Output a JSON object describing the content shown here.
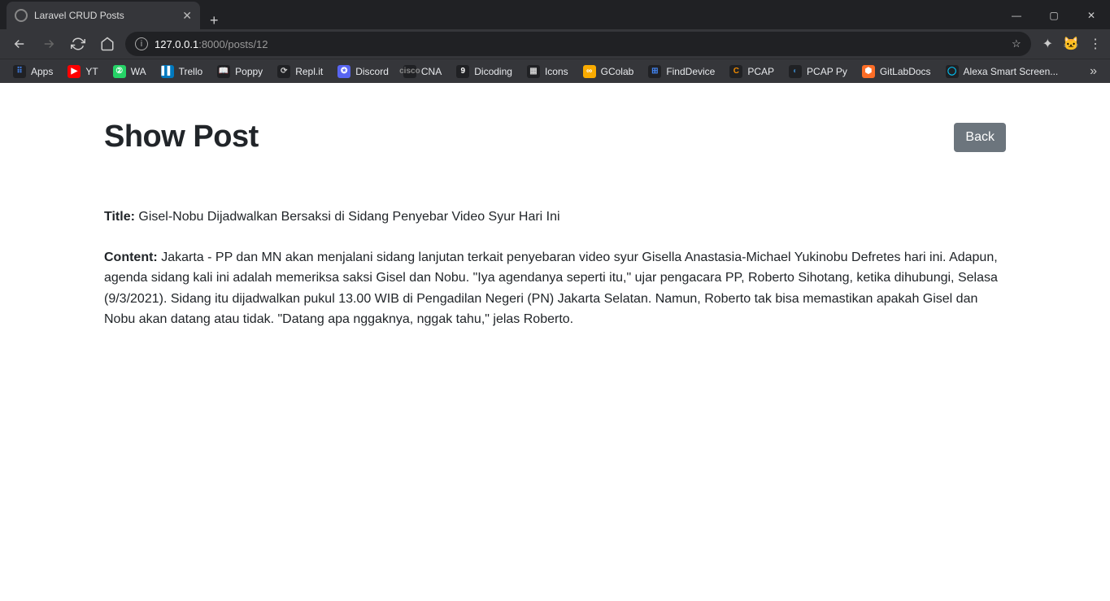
{
  "browser": {
    "tab_title": "Laravel CRUD Posts",
    "url_host": "127.0.0.1",
    "url_port": ":8000",
    "url_path": "/posts/12",
    "bookmarks": [
      {
        "label": "Apps",
        "icon_bg": "#202124",
        "icon_txt": "⠿",
        "icon_color": "#4285f4"
      },
      {
        "label": "YT",
        "icon_bg": "#ff0000",
        "icon_txt": "▶",
        "icon_color": "#fff"
      },
      {
        "label": "WA",
        "icon_bg": "#25d366",
        "icon_txt": "②",
        "icon_color": "#fff"
      },
      {
        "label": "Trello",
        "icon_bg": "#0079bf",
        "icon_txt": "▌▌",
        "icon_color": "#fff"
      },
      {
        "label": "Poppy",
        "icon_bg": "#202124",
        "icon_txt": "📖",
        "icon_color": "#ccc"
      },
      {
        "label": "Repl.it",
        "icon_bg": "#202124",
        "icon_txt": "⟳",
        "icon_color": "#ccc"
      },
      {
        "label": "Discord",
        "icon_bg": "#5865f2",
        "icon_txt": "✪",
        "icon_color": "#fff"
      },
      {
        "label": "CNA",
        "icon_bg": "#202124",
        "icon_txt": "cisco",
        "icon_color": "#888"
      },
      {
        "label": "Dicoding",
        "icon_bg": "#202124",
        "icon_txt": "9",
        "icon_color": "#fff"
      },
      {
        "label": "Icons",
        "icon_bg": "#202124",
        "icon_txt": "▦",
        "icon_color": "#ccc"
      },
      {
        "label": "GColab",
        "icon_bg": "#f9ab00",
        "icon_txt": "∞",
        "icon_color": "#fff"
      },
      {
        "label": "FindDevice",
        "icon_bg": "#202124",
        "icon_txt": "⊞",
        "icon_color": "#4285f4"
      },
      {
        "label": "PCAP",
        "icon_bg": "#202124",
        "icon_txt": "C",
        "icon_color": "#f28b00"
      },
      {
        "label": "PCAP Py",
        "icon_bg": "#202124",
        "icon_txt": "◐",
        "icon_color": "#3776ab"
      },
      {
        "label": "GitLabDocs",
        "icon_bg": "#fc6d26",
        "icon_txt": "⬢",
        "icon_color": "#fff"
      },
      {
        "label": "Alexa Smart Screen...",
        "icon_bg": "#202124",
        "icon_txt": "◯",
        "icon_color": "#00caff"
      }
    ]
  },
  "page": {
    "heading": "Show Post",
    "back_label": "Back",
    "title_label": "Title:",
    "title_value": "Gisel-Nobu Dijadwalkan Bersaksi di Sidang Penyebar Video Syur Hari Ini",
    "content_label": "Content:",
    "content_value": "Jakarta - PP dan MN akan menjalani sidang lanjutan terkait penyebaran video syur Gisella Anastasia-Michael Yukinobu Defretes hari ini. Adapun, agenda sidang kali ini adalah memeriksa saksi Gisel dan Nobu. \"Iya agendanya seperti itu,\" ujar pengacara PP, Roberto Sihotang, ketika dihubungi, Selasa (9/3/2021). Sidang itu dijadwalkan pukul 13.00 WIB di Pengadilan Negeri (PN) Jakarta Selatan. Namun, Roberto tak bisa memastikan apakah Gisel dan Nobu akan datang atau tidak. \"Datang apa nggaknya, nggak tahu,\" jelas Roberto."
  }
}
